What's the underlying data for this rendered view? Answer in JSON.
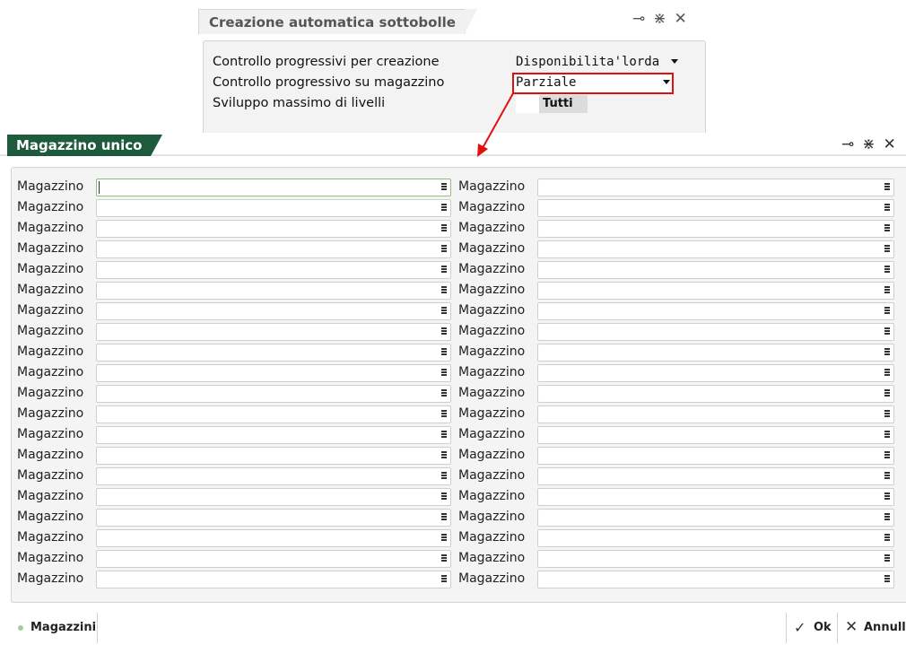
{
  "back_dialog": {
    "title": "Creazione automatica sottobolle",
    "fields": [
      {
        "label": "Controllo progressivi per creazione",
        "value": "Disponibilita'lorda"
      },
      {
        "label": "Controllo progressivo su magazzino",
        "value": "Parziale"
      },
      {
        "label": "Sviluppo massimo di livelli",
        "value": "Tutti"
      }
    ]
  },
  "main_dialog": {
    "title": "Magazzino unico",
    "row_label": "Magazzino",
    "rows_per_column": 20,
    "columns": 2
  },
  "window_controls": {
    "pin": "pin-icon",
    "shrink": "collapse-icon",
    "close": "close-icon"
  },
  "bottom_bar": {
    "magazzini_label": "Magazzini",
    "ok_label": "Ok",
    "cancel_label": "Annulla"
  },
  "colors": {
    "main_tab": "#1e5a3c",
    "highlight": "#e01010",
    "panel_bg": "#f4f4f4"
  }
}
